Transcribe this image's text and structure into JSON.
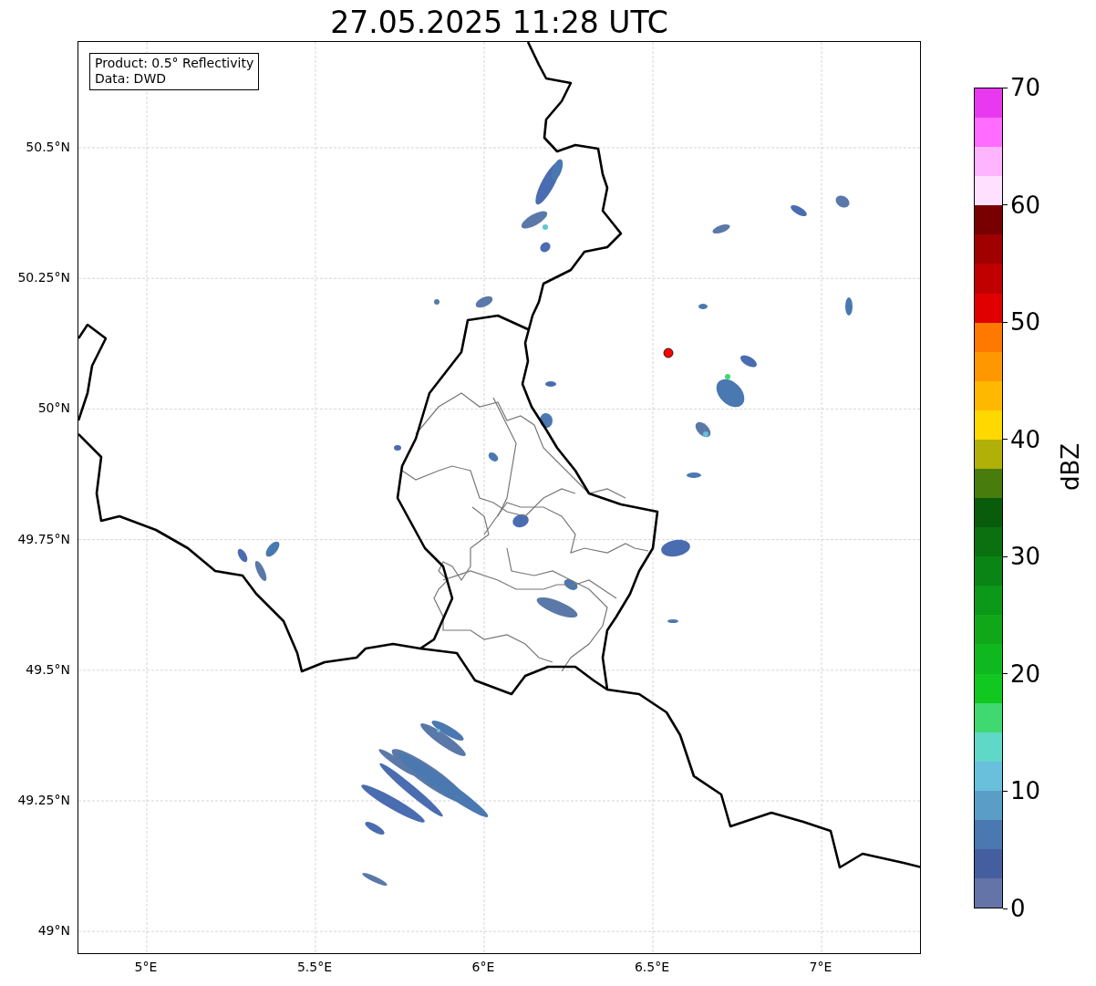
{
  "title": "27.05.2025 11:28 UTC",
  "info_box": {
    "lines": [
      "Product: 0.5° Reflectivity",
      "Data: DWD"
    ]
  },
  "lat_labels": [
    "50.5°N",
    "50.25°N",
    "50°N",
    "49.75°N",
    "49.5°N",
    "49.25°N",
    "49°N"
  ],
  "lon_labels": [
    "5°E",
    "5.5°E",
    "6°E",
    "6.5°E",
    "7°E"
  ],
  "colorbar": {
    "label": "dBZ",
    "ticks": [
      "70",
      "60",
      "50",
      "40",
      "30",
      "20",
      "10",
      "0"
    ],
    "bands": [
      {
        "color": "#e838f0"
      },
      {
        "color": "#ff6cff"
      },
      {
        "color": "#ffb4ff"
      },
      {
        "color": "#ffe0ff"
      },
      {
        "color": "#780000"
      },
      {
        "color": "#a00000"
      },
      {
        "color": "#c00000"
      },
      {
        "color": "#e00000"
      },
      {
        "color": "#ff7800"
      },
      {
        "color": "#ff9800"
      },
      {
        "color": "#ffb800"
      },
      {
        "color": "#ffd800"
      },
      {
        "color": "#b0b008"
      },
      {
        "color": "#487c0c"
      },
      {
        "color": "#085c0c"
      },
      {
        "color": "#0a7010"
      },
      {
        "color": "#0a8414"
      },
      {
        "color": "#0c9818"
      },
      {
        "color": "#10a818"
      },
      {
        "color": "#10b820"
      },
      {
        "color": "#10c820"
      },
      {
        "color": "#40d870"
      },
      {
        "color": "#60d8c8"
      },
      {
        "color": "#68c0dc"
      },
      {
        "color": "#5a9ec8"
      },
      {
        "color": "#4a78b0"
      },
      {
        "color": "#445ea0"
      },
      {
        "color": "#6474a8"
      }
    ]
  }
}
